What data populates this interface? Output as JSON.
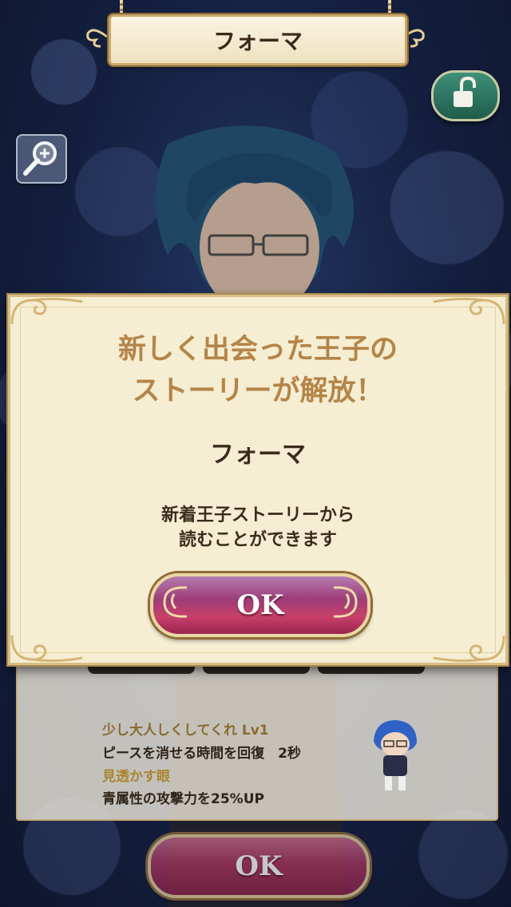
{
  "header": {
    "character_name": "フォーマ"
  },
  "icons": {
    "zoom": "magnifier-plus-icon",
    "lock": "unlocked-padlock-icon"
  },
  "info_panel": {
    "skill_name": "少し大人しくしてくれ Lv1",
    "skill_effect": "ピースを消せる時間を回復　2秒",
    "ability_name": "見透かす眼",
    "ability_effect": "青属性の攻撃力を25%UP",
    "ok_label": "OK"
  },
  "modal": {
    "title_line1": "新しく出会った王子の",
    "title_line2": "ストーリーが解放！",
    "character_name": "フォーマ",
    "message_line1": "新着王子ストーリーから",
    "message_line2": "読むことができます",
    "ok_label": "OK"
  },
  "colors": {
    "accent_gold": "#b58447",
    "button_magenta": "#a8355e",
    "ability_gold": "#a8852e"
  }
}
